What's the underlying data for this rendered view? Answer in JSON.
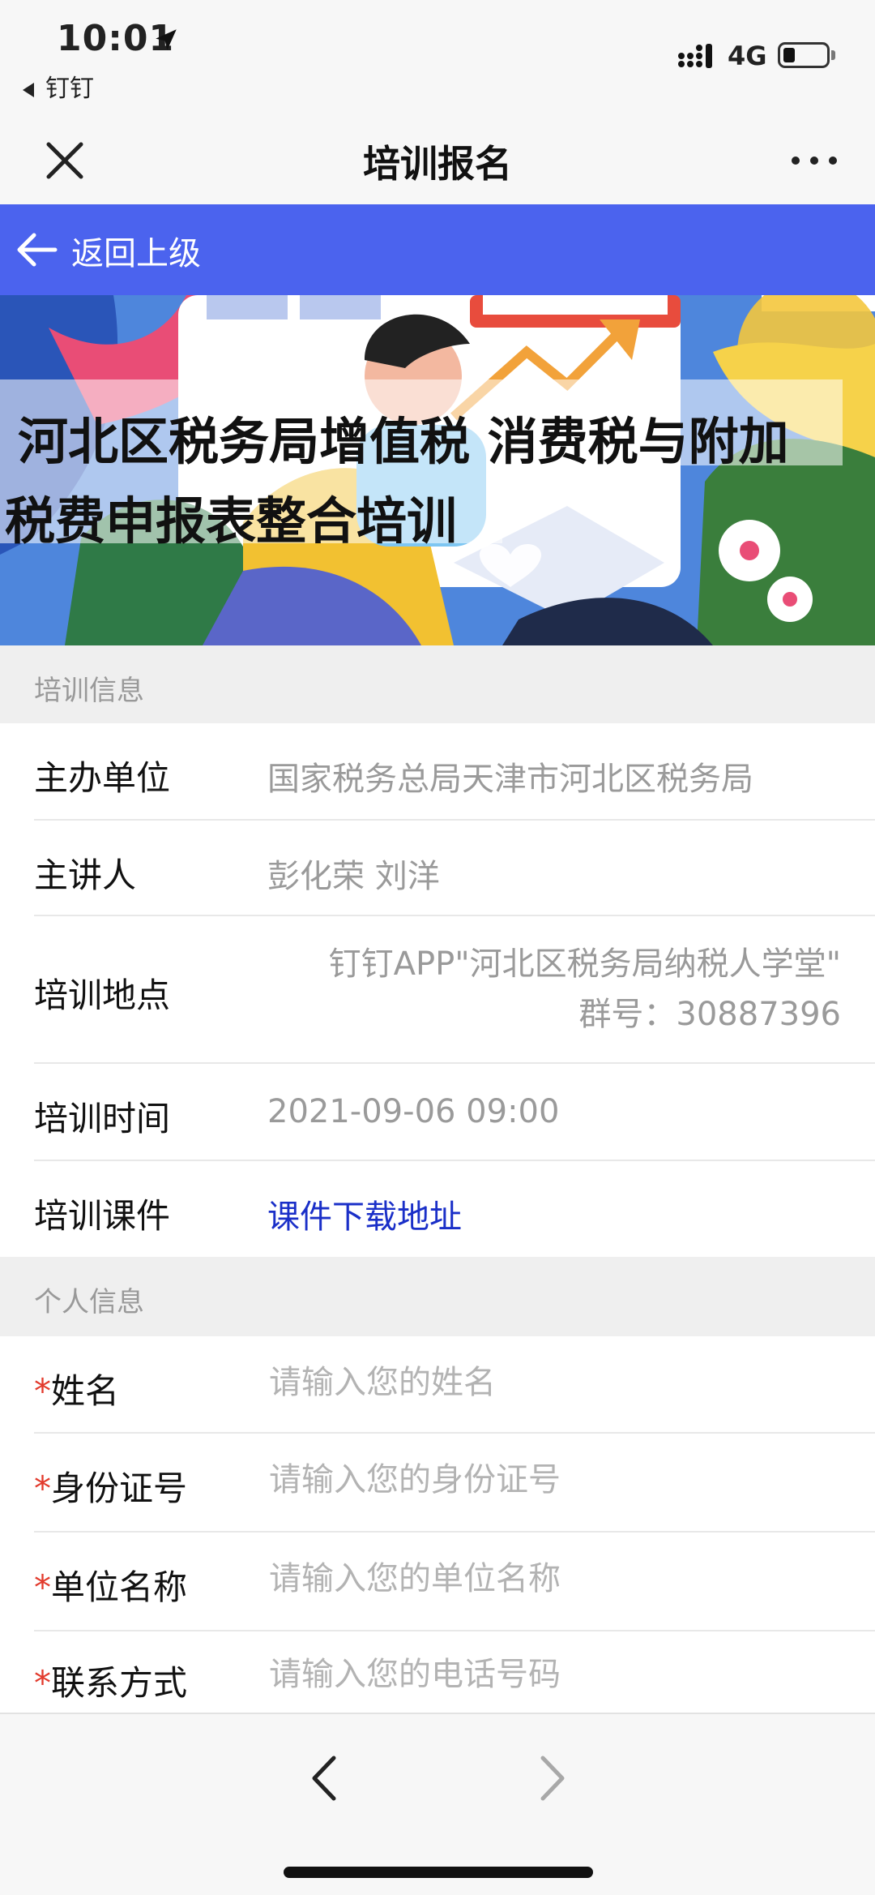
{
  "status_bar": {
    "time": "10:01",
    "back_app": "钉钉",
    "network": "4G"
  },
  "nav": {
    "title": "培训报名"
  },
  "sub_nav": {
    "back_label": "返回上级"
  },
  "banner": {
    "title_line1": "河北区税务局增值税 消费税与附加",
    "title_line2": "税费申报表整合培训"
  },
  "training_info": {
    "header": "培训信息",
    "rows": [
      {
        "label": "主办单位",
        "value": "国家税务总局天津市河北区税务局"
      },
      {
        "label": "主讲人",
        "value": "彭化荣 刘洋"
      },
      {
        "label": "培训地点",
        "value_line1": "钉钉APP\"河北区税务局纳税人学堂\"",
        "value_line2": "群号：30887396"
      },
      {
        "label": "培训时间",
        "value": "2021-09-06 09:00"
      },
      {
        "label": "培训课件",
        "value": "课件下载地址"
      }
    ]
  },
  "personal_info": {
    "header": "个人信息",
    "required_mark": "*",
    "fields": [
      {
        "label": "姓名",
        "placeholder": "请输入您的姓名"
      },
      {
        "label": "身份证号",
        "placeholder": "请输入您的身份证号"
      },
      {
        "label": "单位名称",
        "placeholder": "请输入您的单位名称"
      },
      {
        "label": "联系方式",
        "placeholder": "请输入您的电话号码"
      }
    ]
  },
  "colors": {
    "accent_blue": "#4b63ee",
    "link": "#1a2fc8",
    "required": "#e23a2c"
  },
  "icons": {
    "close": "close-icon",
    "more": "more-icon",
    "back": "back-arrow-icon",
    "prev": "chevron-left-icon",
    "next": "chevron-right-icon"
  }
}
